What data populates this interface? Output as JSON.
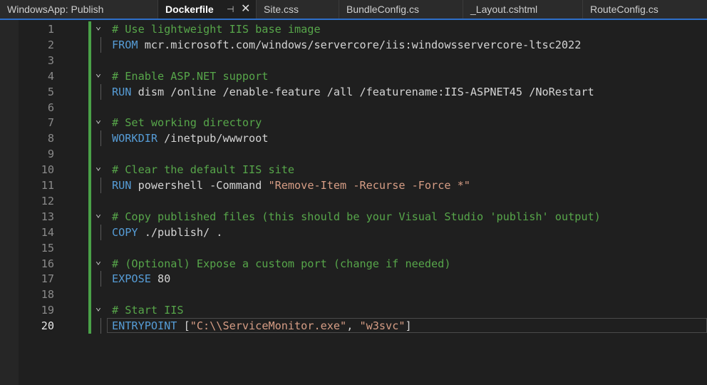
{
  "tabs": [
    {
      "label": "WindowsApp: Publish",
      "active": false
    },
    {
      "label": "Dockerfile",
      "active": true,
      "pin": "⊣",
      "close": "✕"
    },
    {
      "label": "Site.css",
      "active": false
    },
    {
      "label": "BundleConfig.cs",
      "active": false
    },
    {
      "label": "_Layout.cshtml",
      "active": false
    },
    {
      "label": "RouteConfig.cs",
      "active": false
    }
  ],
  "editor": {
    "current_line": 20,
    "lines": [
      {
        "n": "1",
        "parts": [
          {
            "t": "comment",
            "s": "# Use lightweight IIS base image"
          }
        ],
        "fold": true
      },
      {
        "n": "2",
        "parts": [
          {
            "t": "kw",
            "s": "FROM"
          },
          {
            "t": "plain",
            "s": " mcr.microsoft.com/windows/servercore/iis:windowsservercore-ltsc2022"
          }
        ]
      },
      {
        "n": "3",
        "parts": []
      },
      {
        "n": "4",
        "parts": [
          {
            "t": "comment",
            "s": "# Enable ASP.NET support"
          }
        ],
        "fold": true
      },
      {
        "n": "5",
        "parts": [
          {
            "t": "kw",
            "s": "RUN"
          },
          {
            "t": "plain",
            "s": " dism /online /enable-feature /all /featurename:IIS-ASPNET45 /NoRestart"
          }
        ]
      },
      {
        "n": "6",
        "parts": []
      },
      {
        "n": "7",
        "parts": [
          {
            "t": "comment",
            "s": "# Set working directory"
          }
        ],
        "fold": true
      },
      {
        "n": "8",
        "parts": [
          {
            "t": "kw",
            "s": "WORKDIR"
          },
          {
            "t": "plain",
            "s": " /inetpub/wwwroot"
          }
        ]
      },
      {
        "n": "9",
        "parts": []
      },
      {
        "n": "10",
        "parts": [
          {
            "t": "comment",
            "s": "# Clear the default IIS site"
          }
        ],
        "fold": true
      },
      {
        "n": "11",
        "parts": [
          {
            "t": "kw",
            "s": "RUN"
          },
          {
            "t": "plain",
            "s": " powershell -Command "
          },
          {
            "t": "str",
            "s": "\"Remove-Item -Recurse -Force *\""
          }
        ]
      },
      {
        "n": "12",
        "parts": []
      },
      {
        "n": "13",
        "parts": [
          {
            "t": "comment",
            "s": "# Copy published files (this should be your Visual Studio 'publish' output)"
          }
        ],
        "fold": true
      },
      {
        "n": "14",
        "parts": [
          {
            "t": "kw",
            "s": "COPY"
          },
          {
            "t": "plain",
            "s": " ./publish/ ."
          }
        ]
      },
      {
        "n": "15",
        "parts": []
      },
      {
        "n": "16",
        "parts": [
          {
            "t": "comment",
            "s": "# (Optional) Expose a custom port (change if needed)"
          }
        ],
        "fold": true
      },
      {
        "n": "17",
        "parts": [
          {
            "t": "kw",
            "s": "EXPOSE"
          },
          {
            "t": "plain",
            "s": " 80"
          }
        ]
      },
      {
        "n": "18",
        "parts": []
      },
      {
        "n": "19",
        "parts": [
          {
            "t": "comment",
            "s": "# Start IIS"
          }
        ],
        "fold": true
      },
      {
        "n": "20",
        "parts": [
          {
            "t": "kw",
            "s": "ENTRYPOINT"
          },
          {
            "t": "plain",
            "s": " ["
          },
          {
            "t": "str",
            "s": "\"C:\\\\ServiceMonitor.exe\""
          },
          {
            "t": "plain",
            "s": ", "
          },
          {
            "t": "str",
            "s": "\"w3svc\""
          },
          {
            "t": "plain",
            "s": "]"
          }
        ]
      }
    ]
  },
  "colors": {
    "comment": "#57a64a",
    "keyword": "#569cd6",
    "string": "#d69d85",
    "change_bar": "#4aa148",
    "accent": "#2e6fc9"
  },
  "icons": {
    "fold": "chevron-down-icon",
    "pin": "pin-icon",
    "close": "close-icon"
  }
}
